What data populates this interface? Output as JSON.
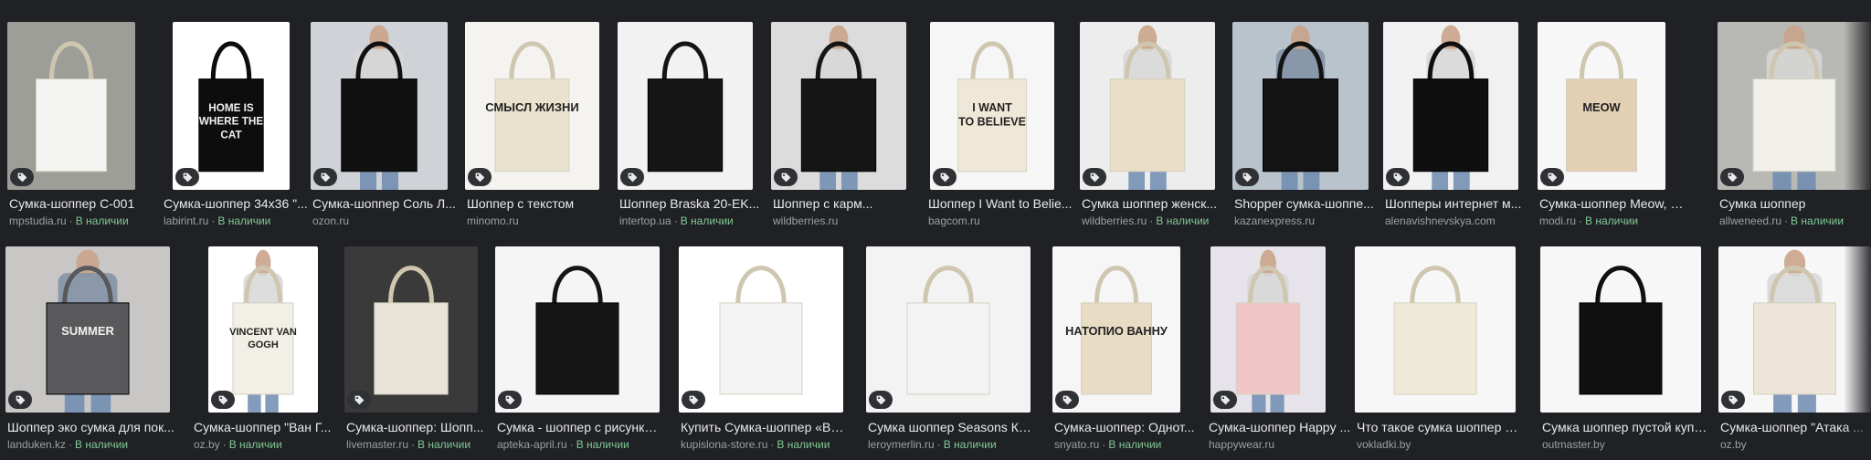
{
  "colors": {
    "background": "#202124",
    "caption": "#e8eaed",
    "source": "#9aa0a6",
    "in_stock": "#81c995",
    "badge": "#303134"
  },
  "results": [
    {
      "caption": "Сумка-шоппер С-001",
      "source": "mpstudia.ru",
      "stock": "В наличии",
      "bag_color": "#f4f4f2",
      "bg": "#9e9e98",
      "print": "",
      "icon": "shopping-tag-icon"
    },
    {
      "caption": "Сумка-шоппер 34x36 \"...",
      "source": "labirint.ru",
      "stock": "В наличии",
      "bag_color": "#0d0d0d",
      "bg": "#ffffff",
      "print": "HOME IS WHERE THE CAT",
      "icon": "shopping-tag-icon"
    },
    {
      "caption": "Сумка-шоппер Соль Л...",
      "source": "ozon.ru",
      "stock": "",
      "bag_color": "#111111",
      "bg": "#cfd2d6",
      "print": "",
      "icon": "shopping-tag-icon"
    },
    {
      "caption": "Шоппер с текстом",
      "source": "minomo.ru",
      "stock": "",
      "bag_color": "#e9e2cf",
      "bg": "#f4f3ef",
      "print": "СМЫСЛ ЖИЗНИ",
      "icon": "shopping-tag-icon"
    },
    {
      "caption": "Шоппер Braska 20-EK...",
      "source": "intertop.ua",
      "stock": "В наличии",
      "bag_color": "#151515",
      "bg": "#f2f2f2",
      "print": "",
      "icon": "shopping-tag-icon"
    },
    {
      "caption": "Шоппер с карм...",
      "source": "wildberries.ru",
      "stock": "",
      "bag_color": "#151515",
      "bg": "#dcdcdc",
      "print": "",
      "icon": "shopping-tag-icon"
    },
    {
      "caption": "Шоппер I Want to Belie...",
      "source": "bagcom.ru",
      "stock": "",
      "bag_color": "#efe8d8",
      "bg": "#f6f6f6",
      "print": "I WANT TO BELIEVE",
      "icon": "shopping-tag-icon"
    },
    {
      "caption": "Сумка шоппер женск...",
      "source": "wildberries.ru",
      "stock": "В наличии",
      "bag_color": "#eadfc6",
      "bg": "#ededed",
      "print": "",
      "icon": "shopping-tag-icon"
    },
    {
      "caption": "Shopper сумка-шоппе...",
      "source": "kazanexpress.ru",
      "stock": "",
      "bag_color": "#131313",
      "bg": "#b9c3cc",
      "print": "",
      "icon": "shopping-tag-icon"
    },
    {
      "caption": "Шопперы интернет м...",
      "source": "alenavishnevskya.com",
      "stock": "",
      "bag_color": "#0f0f0f",
      "bg": "#f1f1f1",
      "print": "",
      "icon": "shopping-tag-icon"
    },
    {
      "caption": "Сумка-шоппер Meow, беже...",
      "source": "modi.ru",
      "stock": "В наличии",
      "bag_color": "#e3cfb3",
      "bg": "#f7f7f7",
      "print": "MEOW",
      "icon": "shopping-tag-icon"
    },
    {
      "caption": "Сумка шоппер",
      "source": "allweneed.ru",
      "stock": "В наличии",
      "bag_color": "#f2f0ea",
      "bg": "#b8b9b4",
      "print": "",
      "icon": "shopping-tag-icon"
    },
    {
      "caption": "Шоппер эко сумка для пок...",
      "source": "landuken.kz",
      "stock": "В наличии",
      "bag_color": "#59595b",
      "bg": "#c9c7c5",
      "print": "SUMMER",
      "icon": "shopping-tag-icon"
    },
    {
      "caption": "Сумка-шоппер \"Ван Г...",
      "source": "oz.by",
      "stock": "В наличии",
      "bag_color": "#f2efe6",
      "bg": "#ffffff",
      "print": "VINCENT VAN GOGH",
      "icon": "shopping-tag-icon"
    },
    {
      "caption": "Сумка-шоппер: Шопп...",
      "source": "livemaster.ru",
      "stock": "В наличии",
      "bag_color": "#e9e4d8",
      "bg": "#3a3a3a",
      "print": "",
      "icon": "shopping-tag-icon"
    },
    {
      "caption": "Сумка - шоппер с рисунком...",
      "source": "apteka-april.ru",
      "stock": "В наличии",
      "bag_color": "#161616",
      "bg": "#f5f5f5",
      "print": "",
      "icon": "shopping-tag-icon"
    },
    {
      "caption": "Купить Сумка-шоппер «Blac...",
      "source": "kupislona-store.ru",
      "stock": "В наличии",
      "bag_color": "#f4f4f4",
      "bg": "#ffffff",
      "print": "",
      "icon": "shopping-tag-icon"
    },
    {
      "caption": "Сумка шоппер Seasons Кош...",
      "source": "leroymerlin.ru",
      "stock": "В наличии",
      "bag_color": "#f3f3f3",
      "bg": "#f3f3f3",
      "print": "",
      "icon": "shopping-tag-icon"
    },
    {
      "caption": "Сумка-шоппер: Однот...",
      "source": "snyato.ru",
      "stock": "В наличии",
      "bag_color": "#e8dcc4",
      "bg": "#f6f6f6",
      "print": "НАТОПИО ВАННУ",
      "icon": "shopping-tag-icon"
    },
    {
      "caption": "Сумка-шоппер Happy ...",
      "source": "happywear.ru",
      "stock": "",
      "bag_color": "#f1c6c6",
      "bg": "#e6e4ea",
      "print": "",
      "icon": "shopping-tag-icon"
    },
    {
      "caption": "Что такое сумка шоппер и ...",
      "source": "vokladki.by",
      "stock": "",
      "bag_color": "#efe9da",
      "bg": "#f7f7f7",
      "print": "",
      "icon": ""
    },
    {
      "caption": "Сумка шоппер пустой купи...",
      "source": "outmaster.by",
      "stock": "",
      "bag_color": "#101010",
      "bg": "#f7f7f7",
      "print": "",
      "icon": ""
    },
    {
      "caption": "Сумка-шоппер \"Атака ...",
      "source": "oz.by",
      "stock": "",
      "bag_color": "#ede6d8",
      "bg": "#f7f7f7",
      "print": "",
      "icon": "shopping-tag-icon"
    }
  ]
}
